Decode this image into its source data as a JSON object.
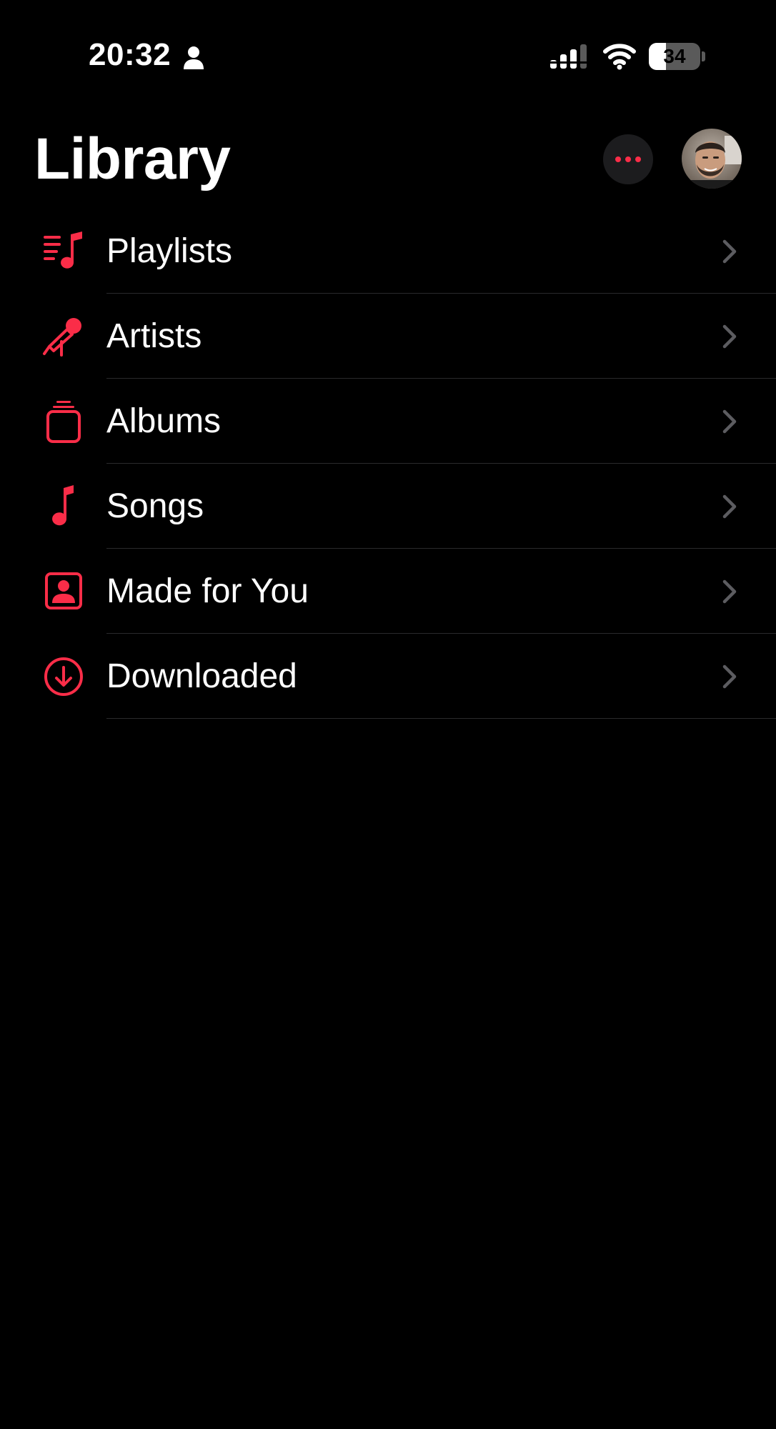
{
  "status_bar": {
    "time": "20:32",
    "battery_level": "34",
    "battery_fraction": 0.34,
    "icons": [
      "person-icon",
      "cellular-signal-icon",
      "wifi-icon",
      "battery-icon"
    ]
  },
  "header": {
    "title": "Library",
    "more_icon": "ellipsis-icon",
    "avatar": "profile-avatar"
  },
  "colors": {
    "accent": "#fa2d48",
    "background": "#000000",
    "separator": "#2a2a2c",
    "chevron": "#5c5c60"
  },
  "library_items": [
    {
      "label": "Playlists",
      "icon": "playlist-icon"
    },
    {
      "label": "Artists",
      "icon": "microphone-icon"
    },
    {
      "label": "Albums",
      "icon": "album-stack-icon"
    },
    {
      "label": "Songs",
      "icon": "music-note-icon"
    },
    {
      "label": "Made for You",
      "icon": "person-square-icon"
    },
    {
      "label": "Downloaded",
      "icon": "download-circle-icon"
    }
  ]
}
